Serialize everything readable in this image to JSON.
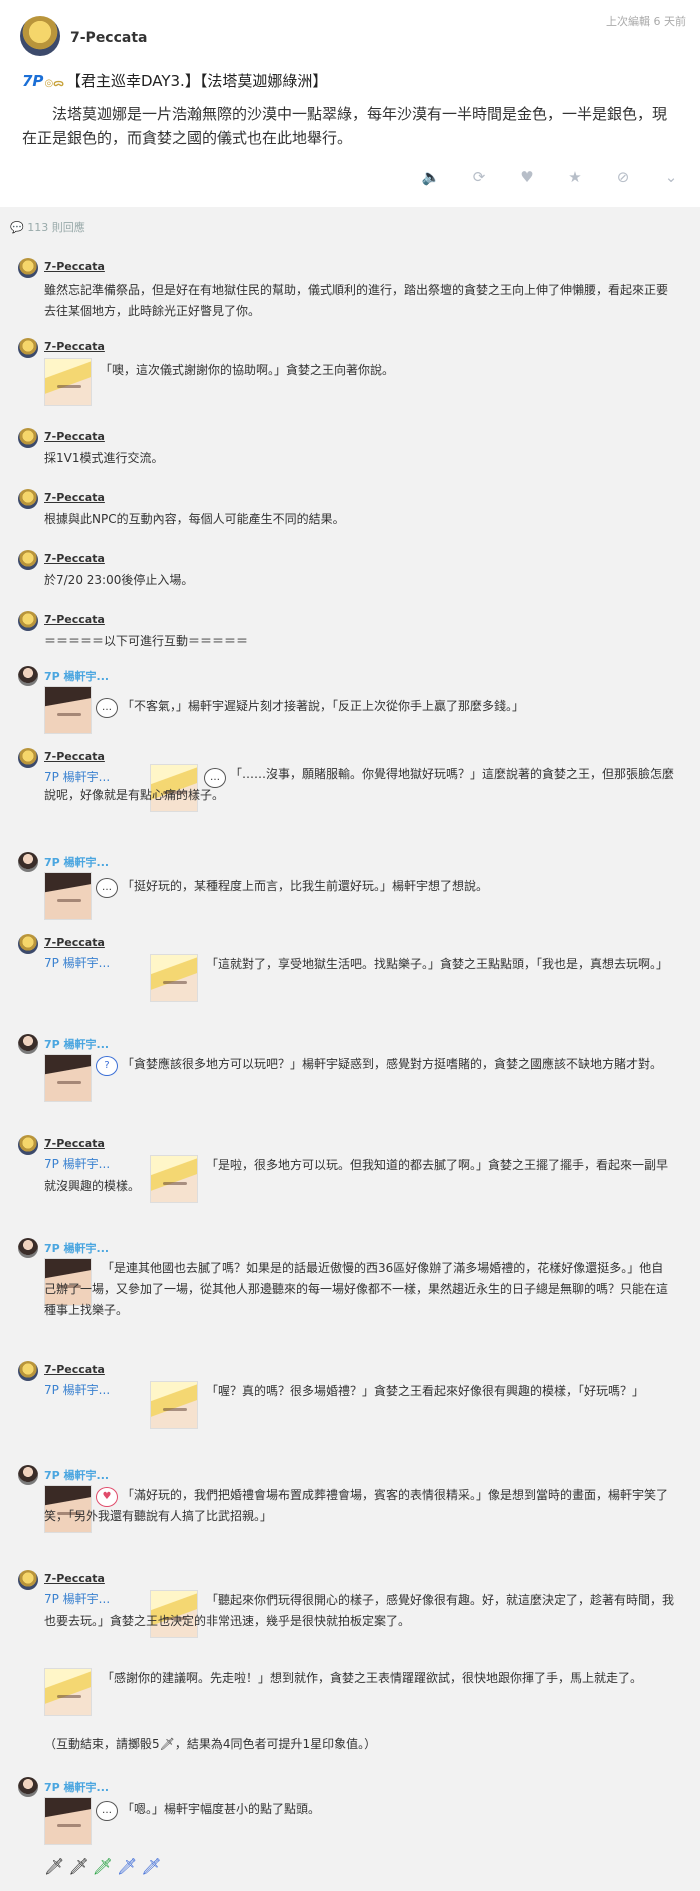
{
  "post": {
    "author": "7-Peccata",
    "edited": "上次編輯 6 天前",
    "badge": "7P",
    "title": "【君主巡幸DAY3.】【法塔莫迦娜綠洲】",
    "body": "法塔莫迦娜是一片浩瀚無際的沙漠中一點翠綠，每年沙漠有一半時間是金色，一半是銀色，現在正是銀色的，而貪婪之國的儀式也在此地舉行。",
    "actions": [
      "speaker-icon",
      "reblog-icon",
      "heart-icon",
      "star-icon",
      "tag-icon",
      "chevron-down-icon"
    ]
  },
  "replies_count": "113 則回應",
  "replies": [
    {
      "author": "7-Peccata",
      "text": "雖然忘記準備祭品，但是好在有地獄住民的幫助，儀式順利的進行，踏出祭壇的貪婪之王向上伸了伸懶腰，看起來正要去往某個地方，此時餘光正好瞥見了你。"
    },
    {
      "author": "7-Peccata",
      "text": "「噢，這次儀式謝謝你的協助啊。」貪婪之王向著你說。"
    },
    {
      "author": "7-Peccata",
      "text": "採1V1模式進行交流。"
    },
    {
      "author": "7-Peccata",
      "text": "根據與此NPC的互動內容，每個人可能產生不同的結果。"
    },
    {
      "author": "7-Peccata",
      "text": "於7/20 23:00後停止入場。"
    },
    {
      "author": "7-Peccata",
      "text": "＝＝＝＝＝以下可進行互動＝＝＝＝＝"
    },
    {
      "author": "7P 楊軒宇...",
      "text": "「不客氣，」楊軒宇遲疑片刻才接著說，「反正上次從你手上贏了那麼多錢。」"
    },
    {
      "author": "7-Peccata",
      "tag": "7P 楊軒宇...",
      "text": "「……沒事，願賭服輸。你覺得地獄好玩嗎？」這麼說著的貪婪之王，但那張臉怎麼說呢，好像就是有點心痛的樣子。"
    },
    {
      "author": "7P 楊軒宇...",
      "text": "「挺好玩的，某種程度上而言，比我生前還好玩。」楊軒宇想了想說。"
    },
    {
      "author": "7-Peccata",
      "tag": "7P 楊軒宇...",
      "text": "「這就對了，享受地獄生活吧。找點樂子。」貪婪之王點點頭，「我也是，真想去玩啊。」"
    },
    {
      "author": "7P 楊軒宇...",
      "text": "「貪婪應該很多地方可以玩吧？」楊軒宇疑惑到，感覺對方挺嗜賭的，貪婪之國應該不缺地方賭才對。"
    },
    {
      "author": "7-Peccata",
      "tag": "7P 楊軒宇...",
      "text": "「是啦，很多地方可以玩。但我知道的都去膩了啊。」貪婪之王擺了擺手，看起來一副早就沒興趣的模樣。"
    },
    {
      "author": "7P 楊軒宇...",
      "text": "「是連其他國也去膩了嗎？如果是的話最近傲慢的西36區好像辦了滿多場婚禮的，花樣好像還挺多。」他自己辦了一場，又參加了一場，從其他人那邊聽來的每一場好像都不一樣，果然趨近永生的日子總是無聊的嗎？只能在這種事上找樂子。"
    },
    {
      "author": "7-Peccata",
      "tag": "7P 楊軒宇...",
      "text": "「喔？真的嗎？很多場婚禮？」貪婪之王看起來好像很有興趣的模樣，「好玩嗎？」"
    },
    {
      "author": "7P 楊軒宇...",
      "text": "「滿好玩的，我們把婚禮會場布置成葬禮會場，賓客的表情很精采。」像是想到當時的畫面，楊軒宇笑了笑，「另外我還有聽說有人搞了比武招親。」"
    },
    {
      "author": "7-Peccata",
      "tag": "7P 楊軒宇...",
      "text": "「聽起來你們玩得很開心的樣子，感覺好像很有趣。好，就這麼決定了，趁著有時間，我也要去玩。」貪婪之王也決定的非常迅速，幾乎是很快就拍板定案了。",
      "text2": "「感謝你的建議啊。先走啦！」想到就作，貪婪之王表情躍躍欲試，很快地跟你揮了手，馬上就走了。",
      "text3": "（互動結束，請擲骰5🗡，結果為4同色者可提升1星印象值。）"
    },
    {
      "author": "7P 楊軒宇...",
      "text": "「嗯。」楊軒宇幅度甚小的點了點頭。"
    }
  ],
  "dice": [
    "🗡",
    "🗡",
    "🗡",
    "🗡",
    "🗡"
  ],
  "colors": {
    "accent": "#4ba6e0",
    "link": "#3b82d0",
    "icon": "#b7bec8"
  }
}
